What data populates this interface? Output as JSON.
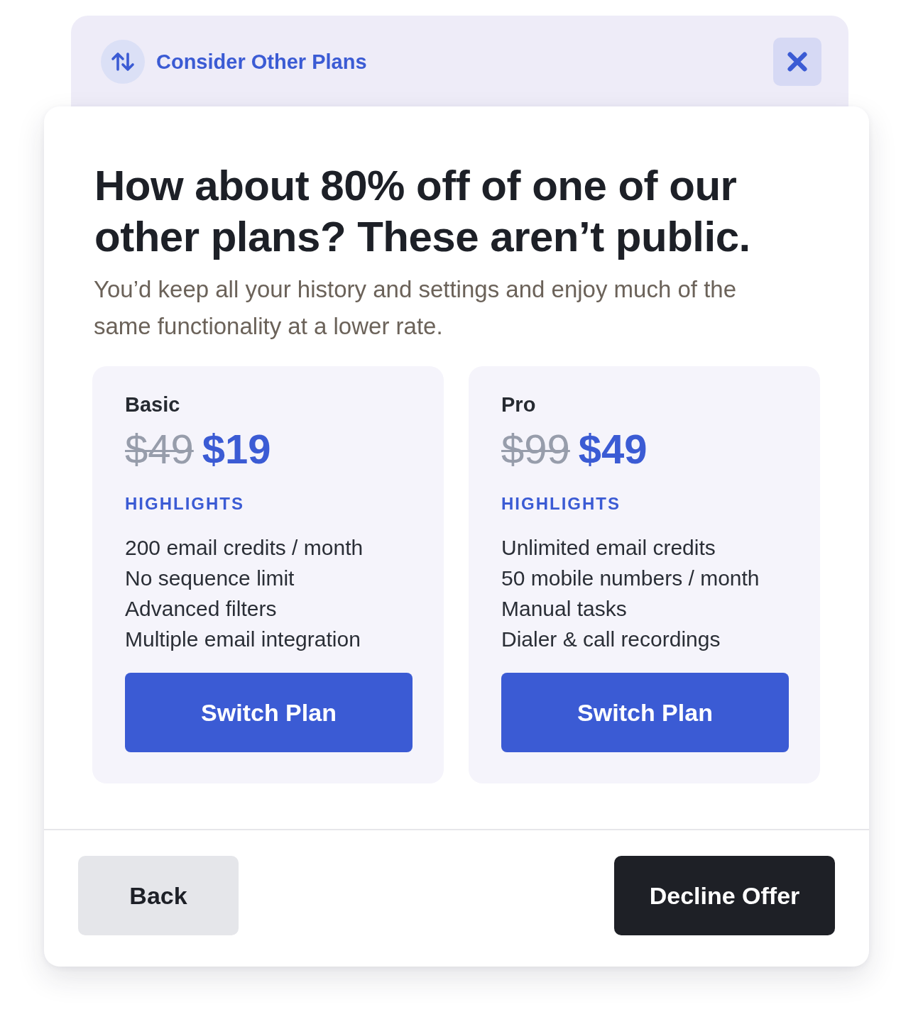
{
  "header": {
    "title": "Consider Other Plans"
  },
  "heading": "How about 80% off of one of our other plans? These aren’t public.",
  "description": "You’d keep all your history and settings and enjoy much of the same functionality at a lower rate.",
  "plans": [
    {
      "name": "Basic",
      "old_price": "$49",
      "price": "$19",
      "highlights_label": "HIGHLIGHTS",
      "features": [
        "200 email credits / month",
        "No sequence limit",
        "Advanced filters",
        "Multiple email integration"
      ],
      "button": "Switch Plan"
    },
    {
      "name": "Pro",
      "old_price": "$99",
      "price": "$49",
      "highlights_label": "HIGHLIGHTS",
      "features": [
        "Unlimited email credits",
        "50 mobile numbers / month",
        "Manual tasks",
        "Dialer & call recordings"
      ],
      "button": "Switch Plan"
    }
  ],
  "footer": {
    "back_button": "Back",
    "decline_button": "Decline Offer"
  }
}
